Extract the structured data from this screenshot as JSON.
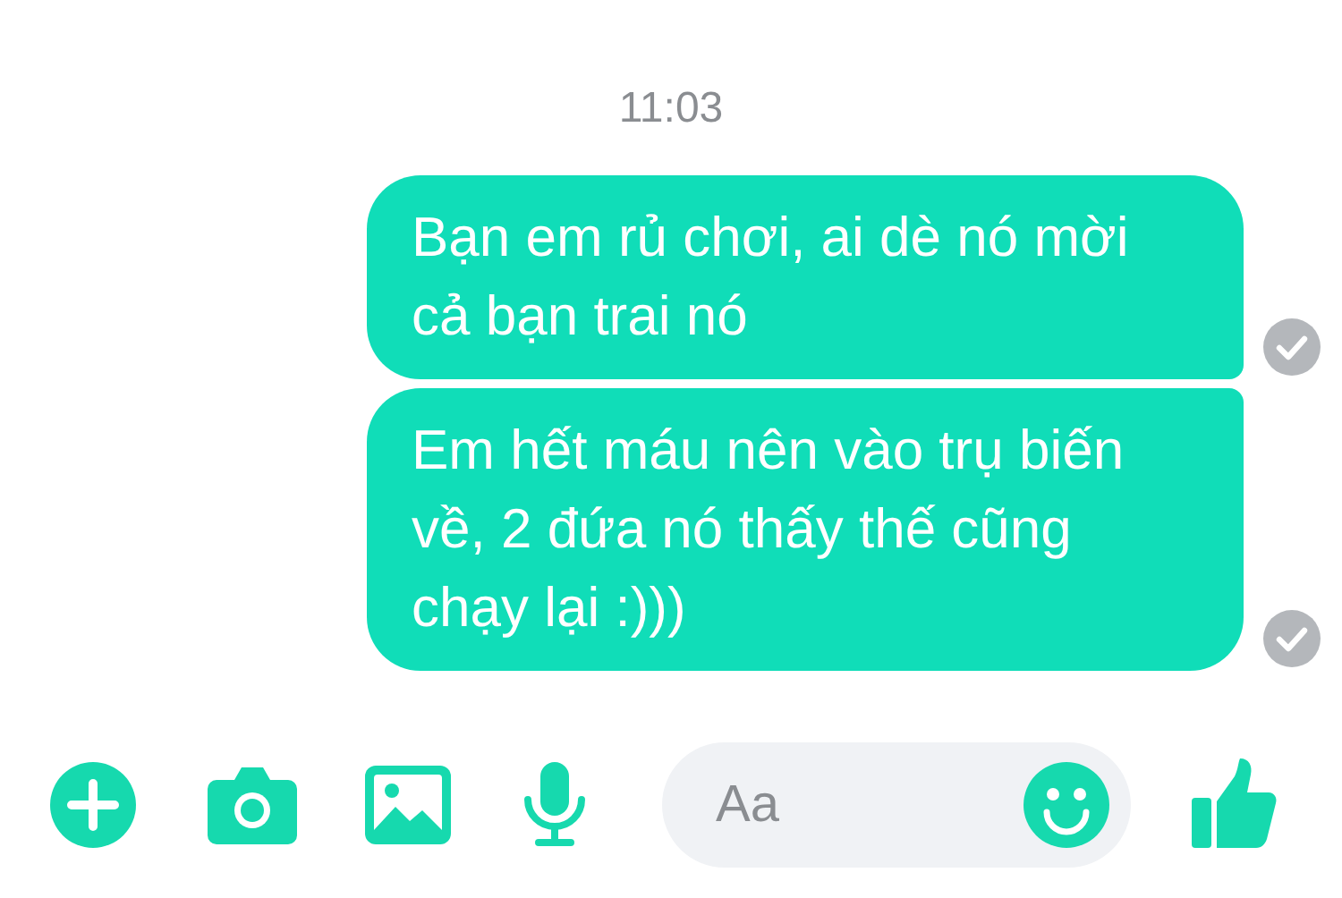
{
  "timestamp": "11:03",
  "messages": [
    {
      "text": "Bạn em rủ chơi, ai dè nó mời cả bạn trai nó",
      "read": true
    },
    {
      "text": "Em hết máu nên vào trụ biến về, 2 đứa nó thấy thế cũng chạy lại :)))",
      "read": true
    }
  ],
  "composer": {
    "placeholder": "Aa"
  }
}
